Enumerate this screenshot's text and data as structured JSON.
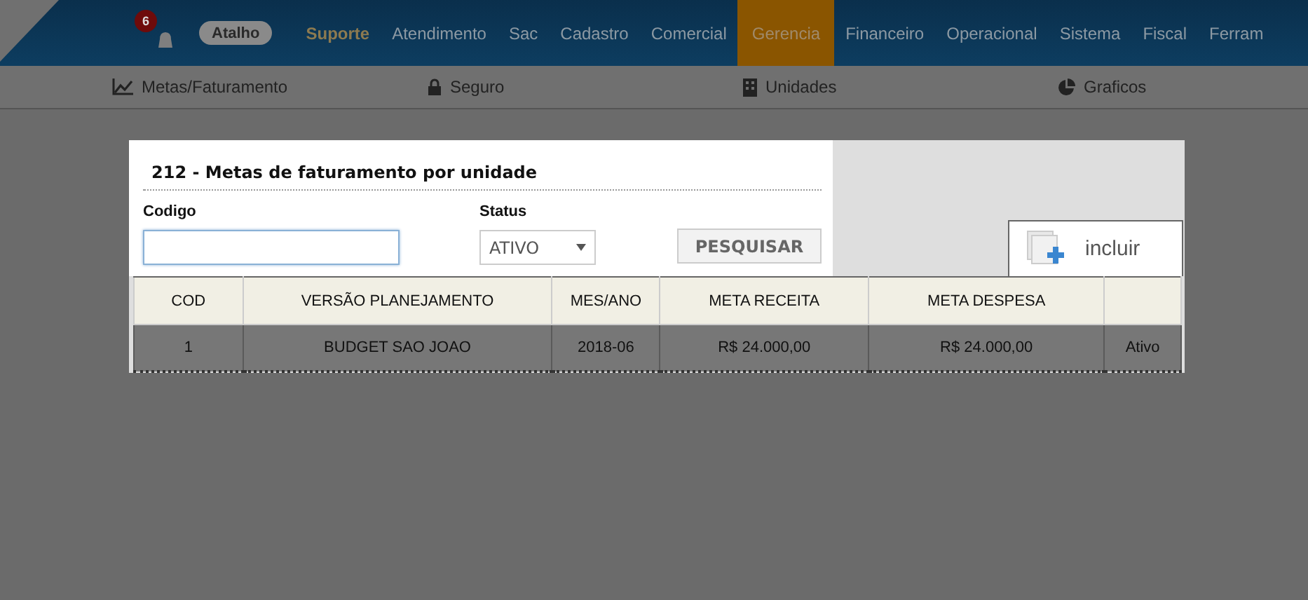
{
  "topbar": {
    "notifications": "6",
    "shortcut": "Atalho",
    "menu": [
      {
        "label": "Suporte",
        "emphasized": true,
        "selected": false
      },
      {
        "label": "Atendimento",
        "emphasized": false,
        "selected": false
      },
      {
        "label": "Sac",
        "emphasized": false,
        "selected": false
      },
      {
        "label": "Cadastro",
        "emphasized": false,
        "selected": false
      },
      {
        "label": "Comercial",
        "emphasized": false,
        "selected": false
      },
      {
        "label": "Gerencia",
        "emphasized": false,
        "selected": true
      },
      {
        "label": "Financeiro",
        "emphasized": false,
        "selected": false
      },
      {
        "label": "Operacional",
        "emphasized": false,
        "selected": false
      },
      {
        "label": "Sistema",
        "emphasized": false,
        "selected": false
      },
      {
        "label": "Fiscal",
        "emphasized": false,
        "selected": false
      },
      {
        "label": "Ferram",
        "emphasized": false,
        "selected": false
      }
    ]
  },
  "submenu": [
    {
      "label": "Metas/Faturamento",
      "kind": "chart"
    },
    {
      "label": "Seguro",
      "kind": "lock"
    },
    {
      "label": "Unidades",
      "kind": "building"
    },
    {
      "label": "Graficos",
      "kind": "pie"
    }
  ],
  "dialog": {
    "title": "212 - Metas de faturamento por unidade",
    "fields": [
      {
        "kind": "text",
        "label": "Codigo"
      },
      {
        "kind": "select",
        "label": "Status",
        "value": "ATIVO"
      }
    ],
    "search_button": "PESQUISAR",
    "add_button": "incluir",
    "table": {
      "columns": [
        "COD",
        "VERSÃO PLANEJAMENTO",
        "MES/ANO",
        "META RECEITA",
        "META DESPESA",
        ""
      ],
      "rows": [
        {
          "cells": [
            "1",
            "BUDGET SAO JOAO",
            "2018-06",
            "R$ 24.000,00",
            "R$ 24.000,00",
            "Ativo"
          ],
          "selected": true
        }
      ]
    }
  }
}
